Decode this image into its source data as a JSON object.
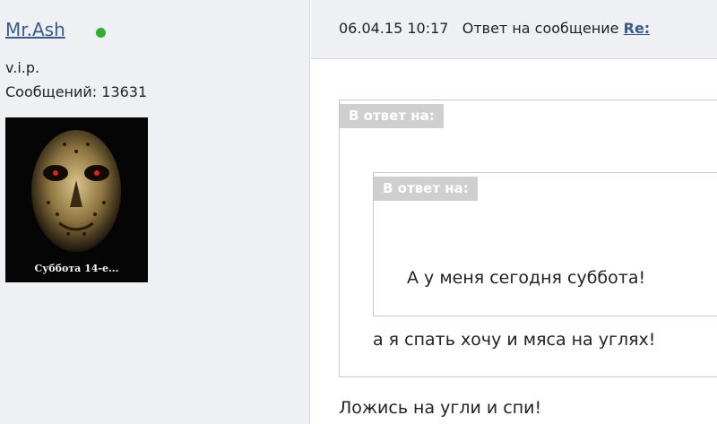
{
  "user": {
    "name": "Mr.Ash",
    "status_color": "#2fae2f",
    "rank": "v.i.p.",
    "posts": "Сообщений: 13631",
    "avatar_caption": "Суббота 14-е..."
  },
  "post": {
    "datetime": "06.04.15 10:17",
    "reply_prefix": "Ответ на сообщение",
    "reply_link": "Re:",
    "quote_outer_label": "В ответ на:",
    "quote_inner_label": "В ответ на:",
    "quote_inner_text": "А у меня сегодня суббота!",
    "quote_outer_text": "а я спать хочу и мяса на углях!",
    "message": "Ложись на угли и спи!"
  }
}
